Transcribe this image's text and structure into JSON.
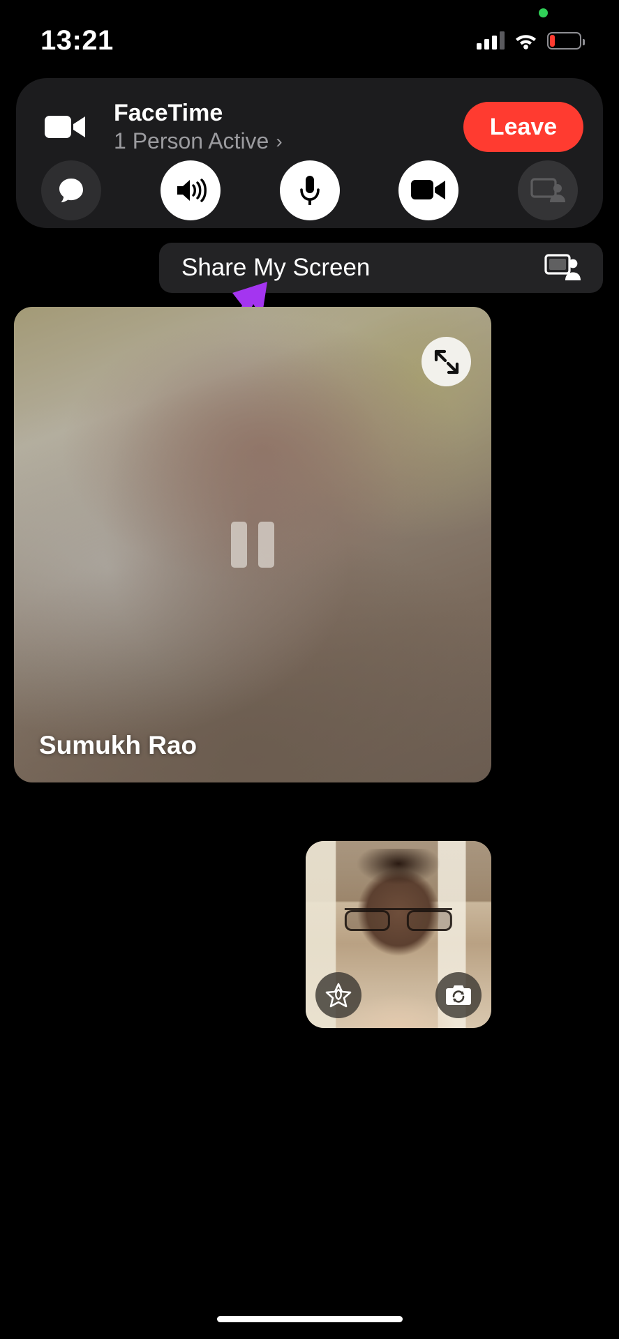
{
  "status_bar": {
    "time": "13:21",
    "signal_icon": "cellular-signal-icon",
    "wifi_icon": "wifi-icon",
    "battery_icon": "battery-low-icon",
    "battery_level_percent": 18,
    "battery_color": "#ff3b30",
    "recording_indicator_color": "#30d158",
    "recording_indicator_icon": "green-privacy-dot-icon"
  },
  "call_banner": {
    "app_icon": "video-camera-icon",
    "title": "FaceTime",
    "subtitle": "1 Person Active",
    "subtitle_chevron": "›",
    "leave_label": "Leave",
    "leave_color": "#ff3b30",
    "background_color": "#1c1c1e",
    "controls": [
      {
        "name": "messages-button",
        "icon": "chat-bubble-icon",
        "state": "inactive"
      },
      {
        "name": "speaker-button",
        "icon": "speaker-wave-icon",
        "state": "active"
      },
      {
        "name": "microphone-button",
        "icon": "microphone-icon",
        "state": "active"
      },
      {
        "name": "camera-button",
        "icon": "video-camera-icon",
        "state": "active"
      },
      {
        "name": "share-screen-button",
        "icon": "screen-share-person-icon",
        "state": "disabled"
      }
    ]
  },
  "share_menu": {
    "label": "Share My Screen",
    "icon": "screen-share-person-icon",
    "background_color": "#232325"
  },
  "annotation": {
    "arrow_icon": "purple-arrow-icon",
    "arrow_color": "#a435f0"
  },
  "video_tile": {
    "participant_name": "Sumukh Rao",
    "expand_icon": "expand-arrows-icon",
    "state_icon": "pause-icon",
    "state": "paused"
  },
  "self_view": {
    "effects_icon": "effects-star-icon",
    "flip_camera_icon": "flip-camera-icon"
  },
  "home_indicator": {
    "name": "home-indicator"
  }
}
